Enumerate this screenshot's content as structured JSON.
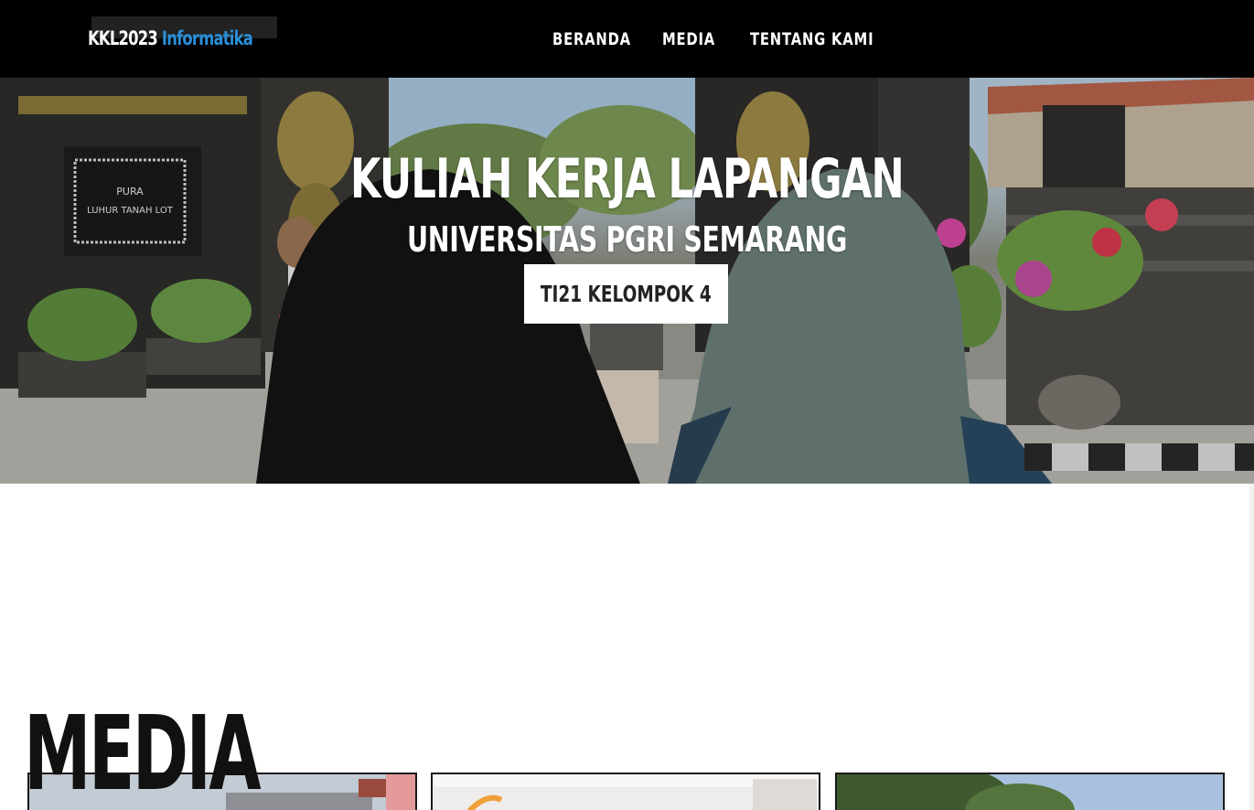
{
  "navbar": {
    "brand_main": "KKL2023",
    "brand_accent": "Informatika",
    "links": [
      {
        "label": "BERANDA"
      },
      {
        "label": "MEDIA"
      },
      {
        "label": "TENTANG KAMI"
      }
    ]
  },
  "hero": {
    "title": "KULIAH KERJA LAPANGAN",
    "subtitle": "UNIVERSITAS PGRI SEMARANG",
    "button_label": "TI21 KELOMPOK 4",
    "temple_sign_line1": "PURA",
    "temple_sign_line2": "LUHUR TANAH LOT"
  },
  "media": {
    "heading": "MEDIA"
  },
  "colors": {
    "navbar_bg": "#000000",
    "brand_accent": "#2a8fd8",
    "button_bg": "#ffffff",
    "page_bg": "#ffffff"
  }
}
